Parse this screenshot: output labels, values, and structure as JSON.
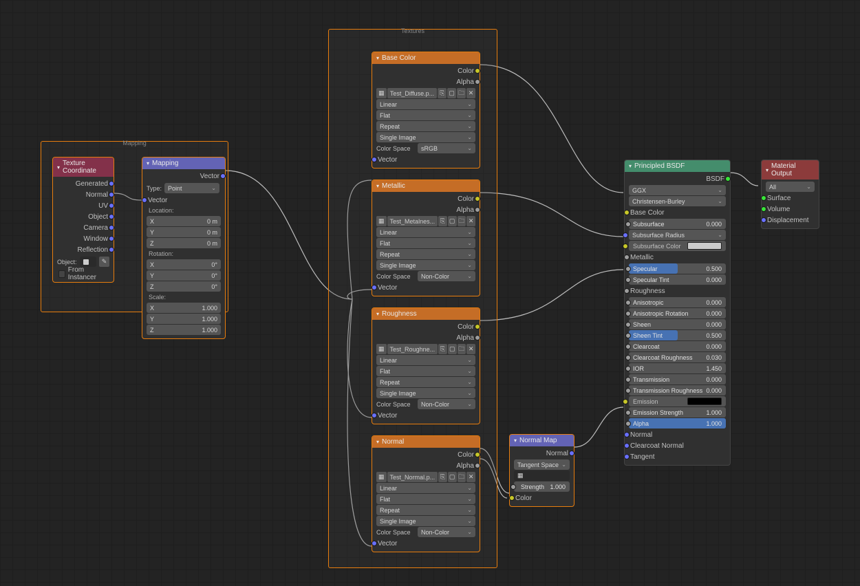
{
  "frames": {
    "mapping": {
      "title": "Mapping"
    },
    "textures": {
      "title": "Textures"
    }
  },
  "texcoord": {
    "title": "Texture Coordinate",
    "outs": [
      "Generated",
      "Normal",
      "UV",
      "Object",
      "Camera",
      "Window",
      "Reflection"
    ],
    "object_label": "Object:",
    "from_instancer": "From Instancer"
  },
  "mapping": {
    "title": "Mapping",
    "out": "Vector",
    "type_label": "Type:",
    "type": "Point",
    "in_vector": "Vector",
    "location": "Location:",
    "rotation": "Rotation:",
    "scale": "Scale:",
    "loc": {
      "x": "0 m",
      "y": "0 m",
      "z": "0 m"
    },
    "rot": {
      "x": "0°",
      "y": "0°",
      "z": "0°"
    },
    "scl": {
      "x": "1.000",
      "y": "1.000",
      "z": "1.000"
    }
  },
  "tex": {
    "basecolor": {
      "title": "Base Color",
      "file": "Test_Diffuse.p...",
      "cs": "sRGB"
    },
    "metallic": {
      "title": "Metallic",
      "file": "Test_Metalnes...",
      "cs": "Non-Color"
    },
    "roughness": {
      "title": "Roughness",
      "file": "Test_Roughne...",
      "cs": "Non-Color"
    },
    "normal": {
      "title": "Normal",
      "file": "Test_Normal.p...",
      "cs": "Non-Color"
    },
    "out_color": "Color",
    "out_alpha": "Alpha",
    "interp": "Linear",
    "proj": "Flat",
    "ext": "Repeat",
    "source": "Single Image",
    "cs_label": "Color Space",
    "in_vector": "Vector"
  },
  "normalmap": {
    "title": "Normal Map",
    "out": "Normal",
    "space": "Tangent Space",
    "strength_label": "Strength",
    "strength": "1.000",
    "in_color": "Color"
  },
  "bsdf": {
    "title": "Principled BSDF",
    "out": "BSDF",
    "dist": "GGX",
    "sss": "Christensen-Burley",
    "ins": {
      "basecolor": "Base Color",
      "subsurface": {
        "l": "Subsurface",
        "v": "0.000"
      },
      "subsurface_radius": "Subsurface Radius",
      "subsurface_color": "Subsurface Color",
      "metallic": "Metallic",
      "specular": {
        "l": "Specular",
        "v": "0.500"
      },
      "specular_tint": {
        "l": "Specular Tint",
        "v": "0.000"
      },
      "roughness": "Roughness",
      "anisotropic": {
        "l": "Anisotropic",
        "v": "0.000"
      },
      "anisotropic_rot": {
        "l": "Anisotropic Rotation",
        "v": "0.000"
      },
      "sheen": {
        "l": "Sheen",
        "v": "0.000"
      },
      "sheen_tint": {
        "l": "Sheen Tint",
        "v": "0.500"
      },
      "clearcoat": {
        "l": "Clearcoat",
        "v": "0.000"
      },
      "clearcoat_rough": {
        "l": "Clearcoat Roughness",
        "v": "0.030"
      },
      "ior": {
        "l": "IOR",
        "v": "1.450"
      },
      "transmission": {
        "l": "Transmission",
        "v": "0.000"
      },
      "transmission_rough": {
        "l": "Transmission Roughness",
        "v": "0.000"
      },
      "emission": "Emission",
      "emission_strength": {
        "l": "Emission Strength",
        "v": "1.000"
      },
      "alpha": {
        "l": "Alpha",
        "v": "1.000"
      },
      "normal": "Normal",
      "clearcoat_normal": "Clearcoat Normal",
      "tangent": "Tangent"
    }
  },
  "output": {
    "title": "Material Output",
    "target": "All",
    "surface": "Surface",
    "volume": "Volume",
    "displacement": "Displacement"
  }
}
